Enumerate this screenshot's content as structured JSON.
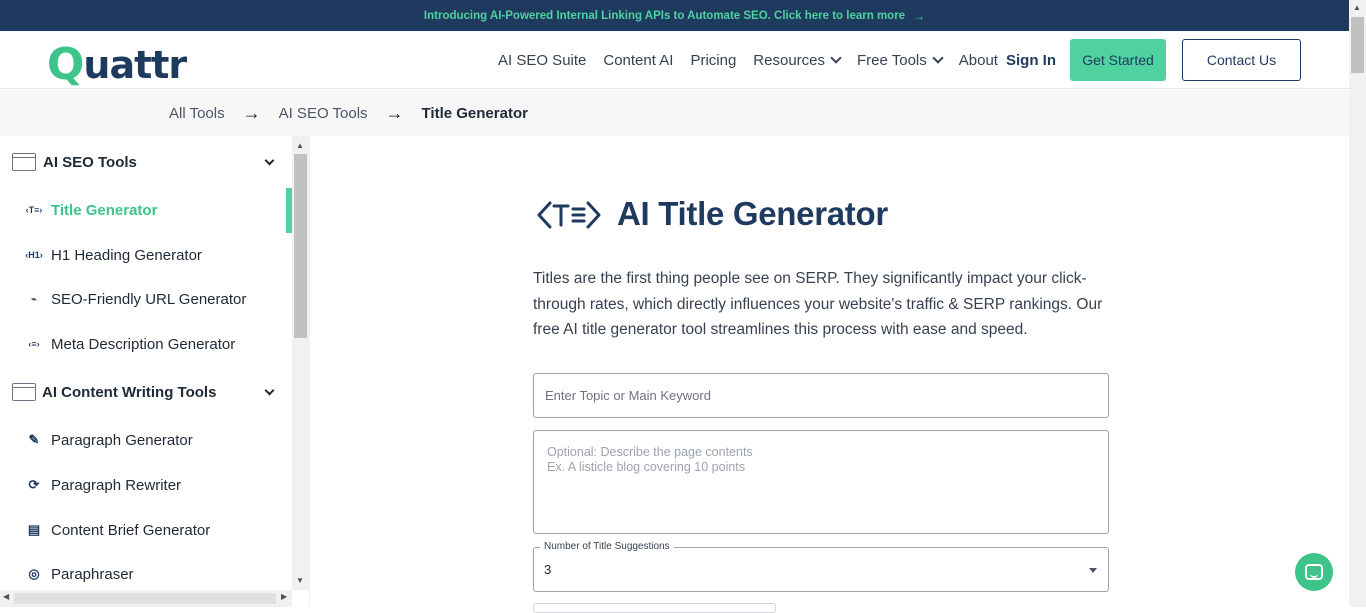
{
  "announcement": {
    "text": "Introducing AI-Powered Internal Linking APIs to Automate SEO. Click here to learn more",
    "arrow": "→"
  },
  "header": {
    "logo_q": "Q",
    "logo_rest": "uattr",
    "nav": [
      "AI SEO Suite",
      "Content AI",
      "Pricing",
      "Resources",
      "Free Tools",
      "About"
    ],
    "sign_in": "Sign In",
    "get_started": "Get Started",
    "contact_us": "Contact Us"
  },
  "breadcrumb": {
    "items": [
      "All Tools",
      "AI SEO Tools",
      "Title Generator"
    ],
    "sep": "→"
  },
  "sidebar": {
    "group1": "AI SEO Tools",
    "group1_items": [
      {
        "icon": "‹T≡›",
        "label": "Title Generator"
      },
      {
        "icon": "‹H1›",
        "label": "H1 Heading Generator"
      },
      {
        "icon": "⌁",
        "label": "SEO-Friendly URL Generator"
      },
      {
        "icon": "‹≡›",
        "label": "Meta Description Generator"
      }
    ],
    "group2": "AI Content Writing Tools",
    "group2_items": [
      {
        "icon": "✎",
        "label": "Paragraph Generator"
      },
      {
        "icon": "⟳",
        "label": "Paragraph Rewriter"
      },
      {
        "icon": "▤",
        "label": "Content Brief Generator"
      },
      {
        "icon": "◎",
        "label": "Paraphraser"
      }
    ]
  },
  "main": {
    "title": "AI Title Generator",
    "description": "Titles are the first thing people see on SERP. They significantly impact your click-through rates, which directly influences your website's traffic & SERP rankings. Our free AI title generator tool streamlines this process with ease and speed.",
    "topic_placeholder": "Enter Topic or Main Keyword",
    "desc_placeholder": "Optional: Describe the page contents\nEx. A listicle blog covering 10 points",
    "suggestions_label": "Number of Title Suggestions",
    "suggestions_value": "3"
  },
  "colors": {
    "navy": "#1e3a5f",
    "accent": "#4fd1a0",
    "accent_dark": "#3cc48a"
  }
}
